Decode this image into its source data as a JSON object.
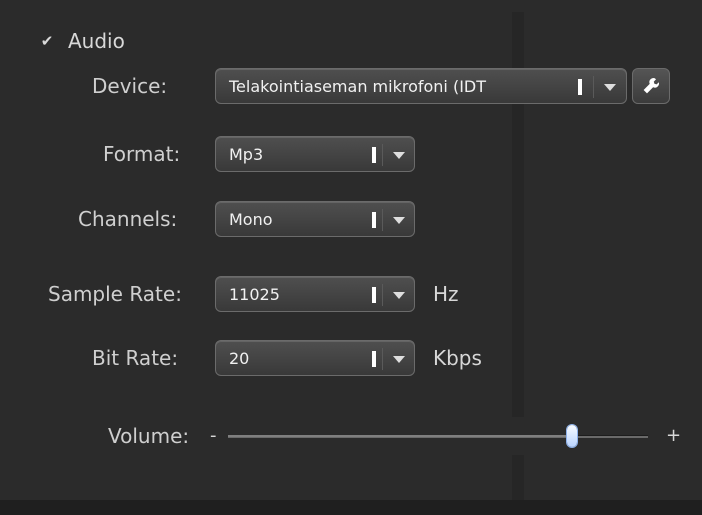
{
  "audio": {
    "label": "Audio",
    "checked": true,
    "check_glyph": "✔"
  },
  "device": {
    "label": "Device:",
    "value": "Telakointiaseman mikrofoni (IDT"
  },
  "format": {
    "label": "Format:",
    "value": "Mp3"
  },
  "channels": {
    "label": "Channels:",
    "value": "Mono"
  },
  "sample_rate": {
    "label": "Sample Rate:",
    "value": "11025",
    "unit": "Hz"
  },
  "bit_rate": {
    "label": "Bit Rate:",
    "value": "20",
    "unit": "Kbps"
  },
  "volume": {
    "label": "Volume:",
    "minus": "-",
    "plus": "+",
    "level": 0.82
  },
  "icons": {
    "checkbox": "check-icon",
    "settings": "wrench-icon",
    "dropdown": "chevron-down-icon"
  },
  "colors": {
    "panel_bg": "#2b2b2b",
    "text": "#d6d6d6",
    "field_bg": "#444444",
    "thumb": "#dce9ff"
  }
}
